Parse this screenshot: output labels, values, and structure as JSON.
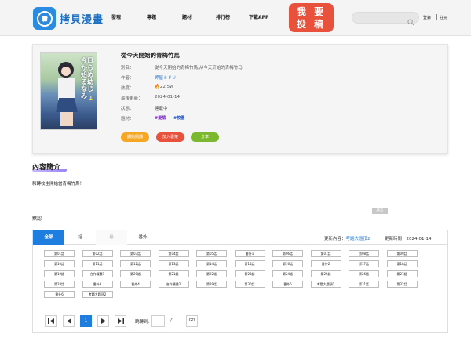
{
  "header": {
    "logo_text": "拷貝漫畫",
    "nav": [
      "發現",
      "專題",
      "題材",
      "排行榜",
      "下載APP"
    ],
    "submit_line1": "我 要",
    "submit_line2": "投 稿",
    "search_placeholder": "",
    "login": "登錄",
    "register": "註冊"
  },
  "comic": {
    "title": "從今天開始的青梅竹馬",
    "cover_title": "今日から始める幼なじみ",
    "cover_volume": "1",
    "alias_label": "別名：",
    "alias": "從今天開始的青梅竹馬,从今天开始的青梅竹马",
    "author_label": "作者：",
    "author": "岬屋ミドリ",
    "heat_label": "熱度：",
    "heat": "22.5W",
    "updated_label": "最後更新：",
    "updated": "2024-01-14",
    "status_label": "狀態：",
    "status": "連載中",
    "genre_label": "題材：",
    "tags": [
      "#愛情",
      "#校園"
    ],
    "buttons": {
      "start": "開始閱讀",
      "add": "加入書架",
      "share": "分享"
    },
    "colors": {
      "start": "#f5a623",
      "add": "#e8513c",
      "share": "#7cb82f"
    }
  },
  "intro": {
    "heading": "內容簡介",
    "text": "和轉校生開始當青梅竹馬！"
  },
  "chapters": {
    "group_label": "默認",
    "ad_label": "廣告",
    "tabs": [
      "全部",
      "話",
      "卷",
      "番外"
    ],
    "latest_label": "更新內容：",
    "latest": "考題大題頂2",
    "time_label": "更新時間：",
    "time": "2024-01-14",
    "items": [
      "第01話",
      "第02話",
      "第03話",
      "第04話",
      "第05話",
      "番外1",
      "第06話",
      "第07話",
      "第08話",
      "第09話",
      "第10話",
      "第11話",
      "第12話",
      "第13話",
      "第14話",
      "第15話",
      "第16話",
      "番外2",
      "第17話",
      "第18話",
      "第19話",
      "合作漫畫1",
      "第20話",
      "第21話",
      "第22話",
      "第23話",
      "第24話",
      "第25話",
      "第26話",
      "第27話",
      "第28話",
      "番外3",
      "番外4",
      "合作漫畫2",
      "第29話",
      "第30話",
      "番外5",
      "考題大題頂1",
      "第31話",
      "第32話",
      "番外6",
      "考題大題頂2"
    ],
    "pager": {
      "current_page": "1",
      "jump_label": "跳轉到:",
      "total": "/1",
      "go": "GO"
    }
  }
}
